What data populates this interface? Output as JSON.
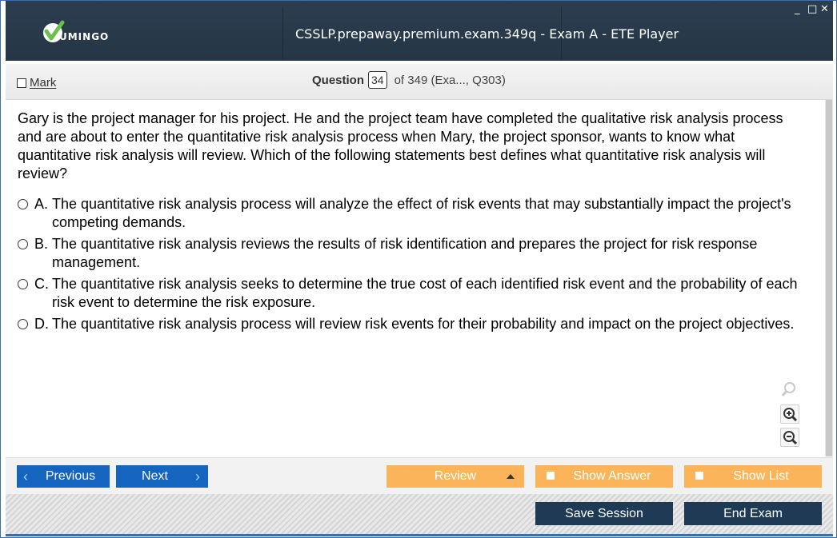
{
  "app": {
    "logo_text": "UMINGO",
    "window_title": "CSSLP.prepaway.premium.exam.349q - Exam A - ETE Player",
    "window_controls": {
      "minimize": "_",
      "maximize": "□",
      "close": "✕"
    },
    "colors": {
      "titlebar": "#2b3d4f",
      "primary_button": "#1565c0",
      "secondary_button": "#fbb45a",
      "dark_button": "#1f3a55",
      "logo_green": "#6cc04a"
    }
  },
  "header": {
    "mark_label": "Mark",
    "question_label": "Question",
    "question_number": "34",
    "question_of": "of 349 (Exa..., Q303)"
  },
  "question": {
    "text": "Gary is the project manager for his project. He and the project team have completed the qualitative risk analysis process and are about to enter the quantitative risk analysis process when Mary, the project sponsor, wants to know what quantitative risk analysis will review. Which of the following statements best defines what quantitative risk analysis will review?",
    "options": [
      {
        "letter": "A.",
        "text": "The quantitative risk analysis process will analyze the effect of risk events that may substantially impact the project's competing demands."
      },
      {
        "letter": "B.",
        "text": "The quantitative risk analysis reviews the results of risk identification and prepares the project for risk response management."
      },
      {
        "letter": "C.",
        "text": "The quantitative risk analysis seeks to determine the true cost of each identified risk event and the probability of each risk event to determine the risk exposure."
      },
      {
        "letter": "D.",
        "text": "The quantitative risk analysis process will review risk events for their probability and impact on the project objectives."
      }
    ]
  },
  "zoom": {
    "icons": [
      "search-icon",
      "zoom-in-icon",
      "zoom-out-icon"
    ]
  },
  "nav": {
    "previous": "Previous",
    "next": "Next",
    "review": "Review",
    "show_answer": "Show Answer",
    "show_list": "Show List",
    "save_session": "Save Session",
    "end_exam": "End Exam"
  }
}
